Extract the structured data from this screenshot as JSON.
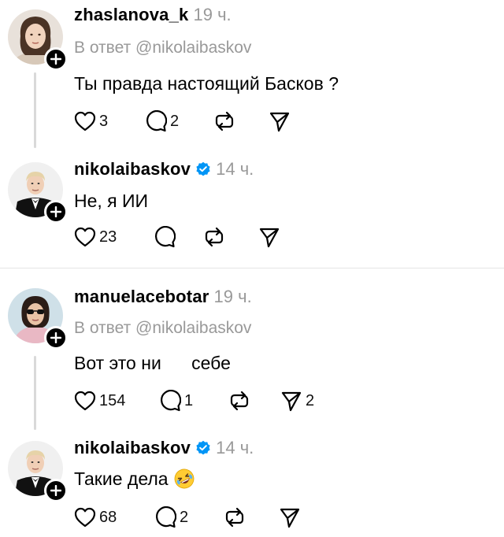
{
  "posts": [
    {
      "username": "zhaslanova_k",
      "time": "19 ч.",
      "reply_to": "В ответ @nikolaibaskov",
      "text": "Ты правда настоящий Басков ?",
      "likes": "3",
      "comments": "2",
      "reposts": "",
      "shares": "",
      "avatar": "woman-portrait"
    },
    {
      "username": "nikolaibaskov",
      "verified": true,
      "time": "14 ч.",
      "text": "Не, я ИИ",
      "likes": "23",
      "comments": "",
      "reposts": "",
      "shares": "",
      "avatar": "man-in-tuxedo"
    },
    {
      "username": "manuelacebotar",
      "time": "19 ч.",
      "reply_to": "В ответ @nikolaibaskov",
      "text": "Вот это ни      себе",
      "likes": "154",
      "comments": "1",
      "reposts": "",
      "shares": "2",
      "avatar": "woman-sunglasses"
    },
    {
      "username": "nikolaibaskov",
      "verified": true,
      "time": "14 ч.",
      "text": "Такие дела",
      "emoji": "rolling-on-floor-laughing-emoji",
      "likes": "68",
      "comments": "2",
      "reposts": "",
      "shares": "",
      "avatar": "man-in-tuxedo"
    }
  ],
  "colors": {
    "verified": "#0095f6",
    "muted": "#999999",
    "thread_line": "#d9d9d9",
    "divider": "#e5e5e5"
  }
}
